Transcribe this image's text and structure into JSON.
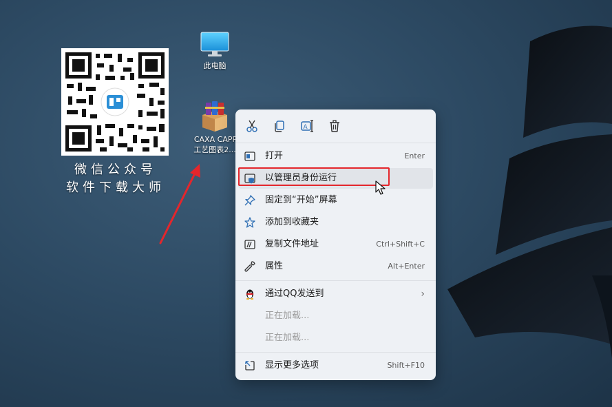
{
  "desktop": {
    "qr_caption_line1": "微信公众号",
    "qr_caption_line2": "软件下载大师",
    "icons": [
      {
        "label": "此电脑",
        "icon": "monitor-icon"
      },
      {
        "label": "CAXA CAPP",
        "label2": "工艺图表2...",
        "icon": "winrar-archive-icon"
      }
    ]
  },
  "context_menu": {
    "toolbar": [
      {
        "name": "cut-icon"
      },
      {
        "name": "copy-icon"
      },
      {
        "name": "rename-icon"
      },
      {
        "name": "delete-icon"
      }
    ],
    "items": [
      {
        "label": "打开",
        "shortcut": "Enter",
        "icon": "open-window-icon"
      },
      {
        "label": "以管理员身份运行",
        "shortcut": "",
        "icon": "shield-icon"
      },
      {
        "label": "固定到“开始”屏幕",
        "shortcut": "",
        "icon": "pin-icon"
      },
      {
        "label": "添加到收藏夹",
        "shortcut": "",
        "icon": "star-icon"
      },
      {
        "label": "复制文件地址",
        "shortcut": "Ctrl+Shift+C",
        "icon": "copy-path-icon"
      },
      {
        "label": "属性",
        "shortcut": "Alt+Enter",
        "icon": "wrench-icon"
      },
      {
        "label": "通过QQ发送到",
        "shortcut": "",
        "icon": "qq-penguin-icon"
      },
      {
        "label": "正在加载...",
        "shortcut": ""
      },
      {
        "label": "正在加载...",
        "shortcut": ""
      },
      {
        "label": "显示更多选项",
        "shortcut": "Shift+F10",
        "icon": "show-more-icon"
      }
    ]
  },
  "colors": {
    "highlight_box": "#e4262c",
    "arrow": "#e4262c",
    "menu_bg": "#eef1f5"
  }
}
